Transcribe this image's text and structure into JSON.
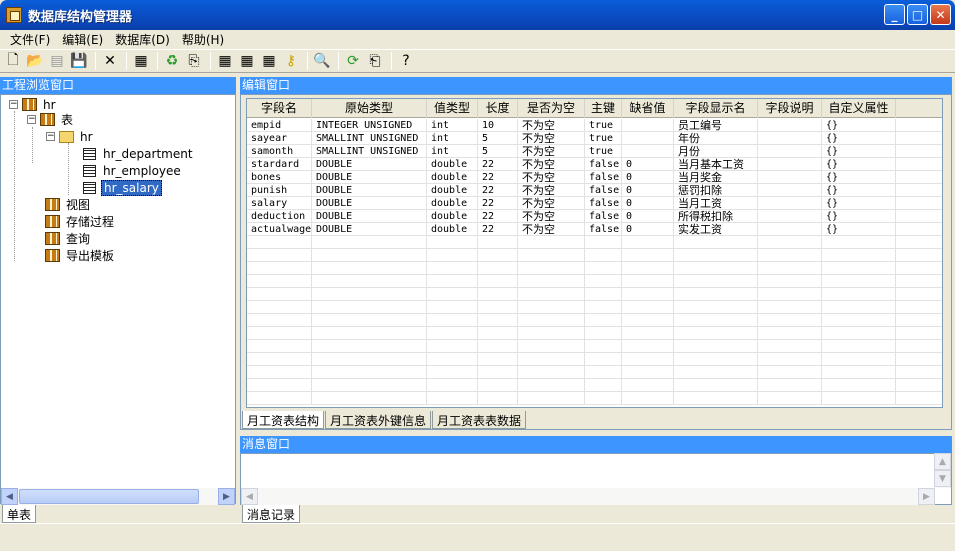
{
  "window": {
    "title": "数据库结构管理器"
  },
  "menu": [
    "文件(F)",
    "编辑(E)",
    "数据库(D)",
    "帮助(H)"
  ],
  "left_panel": {
    "title": "工程浏览窗口",
    "tree": [
      {
        "label": "hr",
        "level": 0,
        "expander": "−",
        "icon": "database-icon"
      },
      {
        "label": "表",
        "level": 1,
        "expander": "−",
        "icon": "database-icon"
      },
      {
        "label": "hr",
        "level": 2,
        "expander": "−",
        "icon": "folder-icon"
      },
      {
        "label": "hr_department",
        "level": 3,
        "icon": "table-icon"
      },
      {
        "label": "hr_employee",
        "level": 3,
        "icon": "table-icon"
      },
      {
        "label": "hr_salary",
        "level": 3,
        "icon": "table-icon",
        "selected": true
      },
      {
        "label": "视图",
        "level": 1,
        "icon": "database-icon"
      },
      {
        "label": "存储过程",
        "level": 1,
        "icon": "database-icon"
      },
      {
        "label": "查询",
        "level": 1,
        "icon": "database-icon"
      },
      {
        "label": "导出模板",
        "level": 1,
        "icon": "database-icon"
      }
    ],
    "tab": "单表"
  },
  "editor": {
    "title": "编辑窗口",
    "columns": [
      "字段名",
      "原始类型",
      "值类型",
      "长度",
      "是否为空",
      "主键",
      "缺省值",
      "字段显示名",
      "字段说明",
      "自定义属性"
    ],
    "rows": [
      [
        "empid",
        "INTEGER UNSIGNED",
        "int",
        "10",
        "不为空",
        "true",
        "",
        "员工编号",
        "",
        "{}"
      ],
      [
        "sayear",
        "SMALLINT UNSIGNED",
        "int",
        "5",
        "不为空",
        "true",
        "",
        "年份",
        "",
        "{}"
      ],
      [
        "samonth",
        "SMALLINT UNSIGNED",
        "int",
        "5",
        "不为空",
        "true",
        "",
        "月份",
        "",
        "{}"
      ],
      [
        "stardard",
        "DOUBLE",
        "double",
        "22",
        "不为空",
        "false",
        "0",
        "当月基本工资",
        "",
        "{}"
      ],
      [
        "bones",
        "DOUBLE",
        "double",
        "22",
        "不为空",
        "false",
        "0",
        "当月奖金",
        "",
        "{}"
      ],
      [
        "punish",
        "DOUBLE",
        "double",
        "22",
        "不为空",
        "false",
        "0",
        "惩罚扣除",
        "",
        "{}"
      ],
      [
        "salary",
        "DOUBLE",
        "double",
        "22",
        "不为空",
        "false",
        "0",
        "当月工资",
        "",
        "{}"
      ],
      [
        "deduction",
        "DOUBLE",
        "double",
        "22",
        "不为空",
        "false",
        "0",
        "所得税扣除",
        "",
        "{}"
      ],
      [
        "actualwage",
        "DOUBLE",
        "double",
        "22",
        "不为空",
        "false",
        "0",
        "实发工资",
        "",
        "{}"
      ]
    ],
    "tabs": [
      "月工资表结构",
      "月工资表外键信息",
      "月工资表表数据"
    ]
  },
  "message": {
    "title": "消息窗口",
    "tab": "消息记录"
  },
  "toolbar_icons": [
    "new-file-icon",
    "open-folder-icon",
    "save-all-icon",
    "save-icon",
    "delete-icon",
    "properties-icon",
    "refresh-icon",
    "export-icon",
    "table-add-icon",
    "table-edit-icon",
    "table-remove-icon",
    "key-icon",
    "preview-icon",
    "sync-icon",
    "import-icon",
    "help-icon"
  ]
}
